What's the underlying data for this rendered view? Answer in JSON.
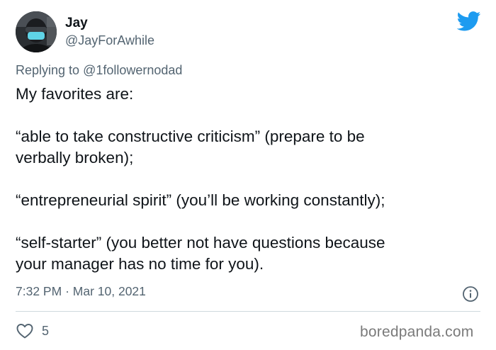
{
  "author": {
    "display_name": "Jay",
    "handle": "@JayForAwhile",
    "avatar_icon": "person-with-mask-avatar"
  },
  "brand": {
    "icon": "twitter-bird-icon",
    "color": "#1d9bf0"
  },
  "reply": {
    "prefix": "Replying to",
    "mention": "@1followernodad"
  },
  "tweet": {
    "paragraphs": [
      [
        "My favorites are:"
      ],
      [
        "“able to take constructive criticism” (prepare to be",
        "verbally broken);"
      ],
      [
        "“entrepreneurial spirit” (you’ll be working constantly);"
      ],
      [
        "“self-starter” (you better not have questions because",
        "your manager has no time for you)."
      ]
    ],
    "time": "7:32 PM",
    "separator": "·",
    "date": "Mar 10, 2021"
  },
  "engagement": {
    "likes": "5"
  },
  "watermark": "boredpanda.com",
  "colors": {
    "text": "#0f1419",
    "secondary": "#536471",
    "divider": "#cfd9de"
  }
}
